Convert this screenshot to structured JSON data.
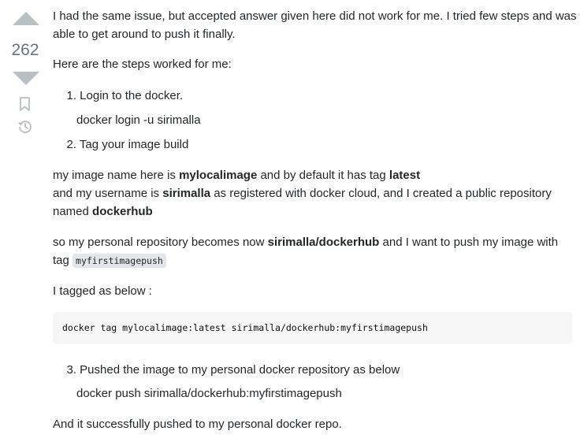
{
  "vote": {
    "count": "262",
    "upvote_icon": "upvote-arrow-icon",
    "downvote_icon": "downvote-arrow-icon",
    "bookmark_icon": "bookmark-icon",
    "history_icon": "history-icon"
  },
  "post": {
    "intro_line1": "I had the same issue, but accepted answer given here did not work for me. I tried few steps and was",
    "intro_line2": "able to get around to push it finally.",
    "steps_heading": "Here are the steps worked for me:",
    "step1": {
      "num": "1.",
      "text": "Login to the docker."
    },
    "step1_cmd": "docker login -u sirimalla",
    "step2": {
      "num": "2.",
      "text": "Tag your image build"
    },
    "para1": {
      "t1": "my image name here is ",
      "b1": "mylocalimage",
      "t2": " and by default it has tag ",
      "b2": "latest",
      "t3": "and my username is ",
      "b3": "sirimalla",
      "t4": " as registered with docker cloud, and I created a public repository",
      "t5": "named ",
      "b4": "dockerhub"
    },
    "para2": {
      "t1": "so my personal repository becomes now ",
      "b1": "sirimalla/dockerhub",
      "t2": " and I want to push my image with",
      "t3": "tag ",
      "code": "myfirstimagepush"
    },
    "tagged_as": "I tagged as below :",
    "code_block": "docker tag mylocalimage:latest sirimalla/dockerhub:myfirstimagepush",
    "step3": {
      "num": "3.",
      "text": "Pushed the image to my personal docker repository as below"
    },
    "step3_cmd": "docker push sirimalla/dockerhub:myfirstimagepush",
    "closing": "And it successfully pushed to my personal docker repo."
  },
  "colors": {
    "text": "#232629",
    "vote_arrow": "#babfc4",
    "vote_count": "#6a737c",
    "code_bg": "#f6f6f6",
    "inline_code_bg": "#e3e6e8"
  }
}
